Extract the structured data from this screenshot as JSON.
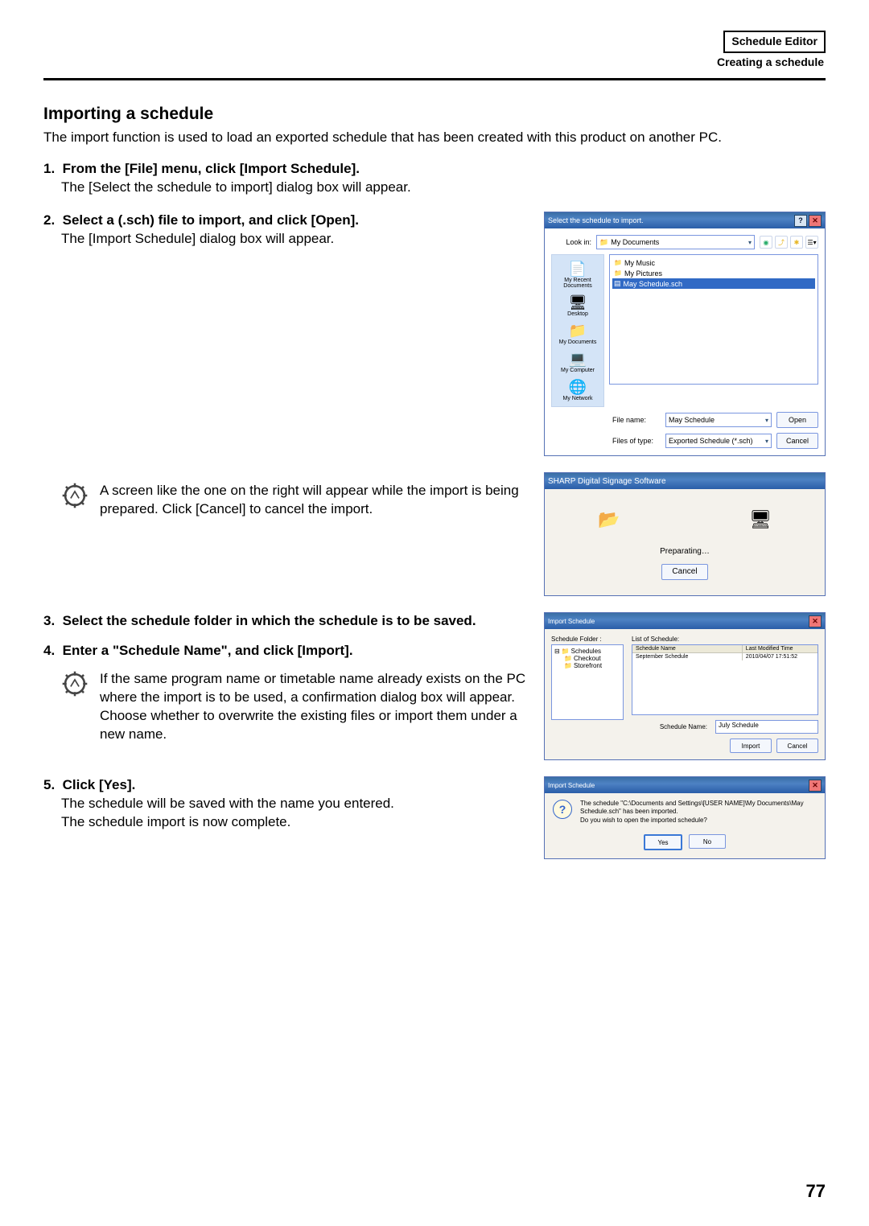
{
  "header": {
    "box": "Schedule Editor",
    "sub": "Creating a schedule"
  },
  "section_title": "Importing a schedule",
  "intro": "The import function is used to load an exported schedule that has been created with this product on another PC.",
  "step1": {
    "bold": "From the [File] menu, click [Import Schedule].",
    "body": "The [Select the schedule to import] dialog box will appear."
  },
  "step2": {
    "bold": "Select a (.sch) file to import, and click [Open].",
    "body": "The [Import Schedule] dialog box will appear."
  },
  "tip1": "A screen like the one on the right will appear while the import is being prepared. Click [Cancel] to cancel the import.",
  "step3": {
    "bold": "Select the schedule folder in which the schedule is to be saved."
  },
  "step4": {
    "bold": "Enter a \"Schedule Name\", and click [Import]."
  },
  "tip2": "If the same program name or timetable name already exists on the PC where the import is to be used, a confirmation dialog box will appear. Choose whether to overwrite the existing files or import them under a new name.",
  "step5": {
    "bold": "Click [Yes].",
    "body1": "The schedule will be saved with the name you entered.",
    "body2": "The schedule import is now complete."
  },
  "file_dialog": {
    "title": "Select the schedule to import.",
    "lookin_label": "Look in:",
    "lookin_value": "My Documents",
    "places": [
      "My Recent Documents",
      "Desktop",
      "My Documents",
      "My Computer",
      "My Network"
    ],
    "files": {
      "music": "My Music",
      "pictures": "My Pictures",
      "sel": "May Schedule.sch"
    },
    "filename_label": "File name:",
    "filename_value": "May Schedule",
    "filetype_label": "Files of type:",
    "filetype_value": "Exported Schedule (*.sch)",
    "open": "Open",
    "cancel": "Cancel"
  },
  "progress": {
    "title": "SHARP Digital Signage Software",
    "status": "Preparating…",
    "cancel": "Cancel"
  },
  "import_dialog": {
    "title": "Import Schedule",
    "folder_label": "Schedule Folder :",
    "list_label": "List of Schedule:",
    "tree_root": "Schedules",
    "tree": [
      "Checkout",
      "Storefront"
    ],
    "col1": "Schedule Name",
    "col2": "Last Modified Time",
    "row_name": "September Schedule",
    "row_time": "2010/04/07 17:51:52",
    "name_label": "Schedule Name:",
    "name_value": "July Schedule",
    "import": "Import",
    "cancel": "Cancel"
  },
  "confirm": {
    "title": "Import Schedule",
    "msg1": "The schedule \"C:\\Documents and Settings\\[USER NAME]\\My Documents\\May Schedule.sch\" has been imported.",
    "msg2": "Do you wish to open the imported schedule?",
    "yes": "Yes",
    "no": "No"
  },
  "page_number": "77"
}
